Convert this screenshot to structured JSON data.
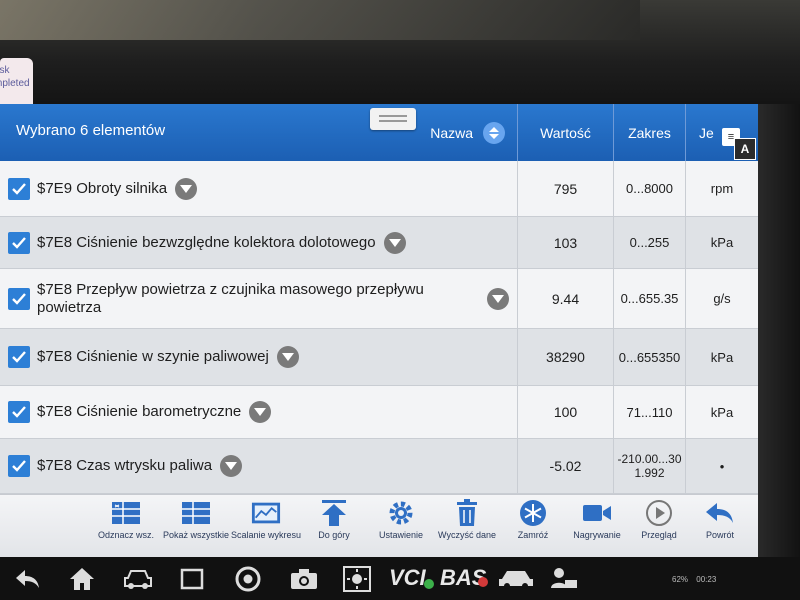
{
  "sticker": {
    "line1": "ask",
    "line2": "mpleted"
  },
  "header": {
    "selected_count": "Wybrano 6 elementów",
    "columns": {
      "name": "Nazwa",
      "value": "Wartość",
      "range": "Zakres",
      "unit": "Je"
    }
  },
  "rows": [
    {
      "name": "$7E9 Obroty silnika",
      "value": "795",
      "range": "0...8000",
      "unit": "rpm",
      "checked": true
    },
    {
      "name": "$7E8 Ciśnienie bezwzględne kolektora dolotowego",
      "value": "103",
      "range": "0...255",
      "unit": "kPa",
      "checked": true
    },
    {
      "name": "$7E8 Przepływ powietrza z czujnika masowego przepływu powietrza",
      "value": "9.44",
      "range": "0...655.35",
      "unit": "g/s",
      "checked": true
    },
    {
      "name": "$7E8 Ciśnienie w szynie paliwowej",
      "value": "38290",
      "range": "0...655350",
      "unit": "kPa",
      "checked": true
    },
    {
      "name": "$7E8 Ciśnienie barometryczne",
      "value": "100",
      "range": "71...110",
      "unit": "kPa",
      "checked": true
    },
    {
      "name": "$7E8 Czas wtrysku paliwa",
      "value": "-5.02",
      "range": "-210.00...30 1.992",
      "unit": "•",
      "checked": true
    }
  ],
  "toolbar": [
    {
      "label": "Odznacz wsz.",
      "icon": "deselect-all-icon"
    },
    {
      "label": "Pokaż wszystkie",
      "icon": "show-all-icon"
    },
    {
      "label": "Scalanie wykresu",
      "icon": "merge-chart-icon"
    },
    {
      "label": "Do góry",
      "icon": "to-top-icon"
    },
    {
      "label": "Ustawienie",
      "icon": "settings-gear-icon"
    },
    {
      "label": "Wyczyść dane",
      "icon": "trash-icon"
    },
    {
      "label": "Zamróź",
      "icon": "freeze-snowflake-icon"
    },
    {
      "label": "Nagrywanie",
      "icon": "video-camera-icon"
    },
    {
      "label": "Przegląd",
      "icon": "play-review-icon"
    },
    {
      "label": "Powrót",
      "icon": "back-arrow-icon"
    }
  ],
  "navbar": {
    "vci": "VCI",
    "bas": "BAS",
    "battery": "62%",
    "time": "00:23"
  },
  "colors": {
    "header_blue": "#1f63b8",
    "accent": "#2d7fd6"
  }
}
